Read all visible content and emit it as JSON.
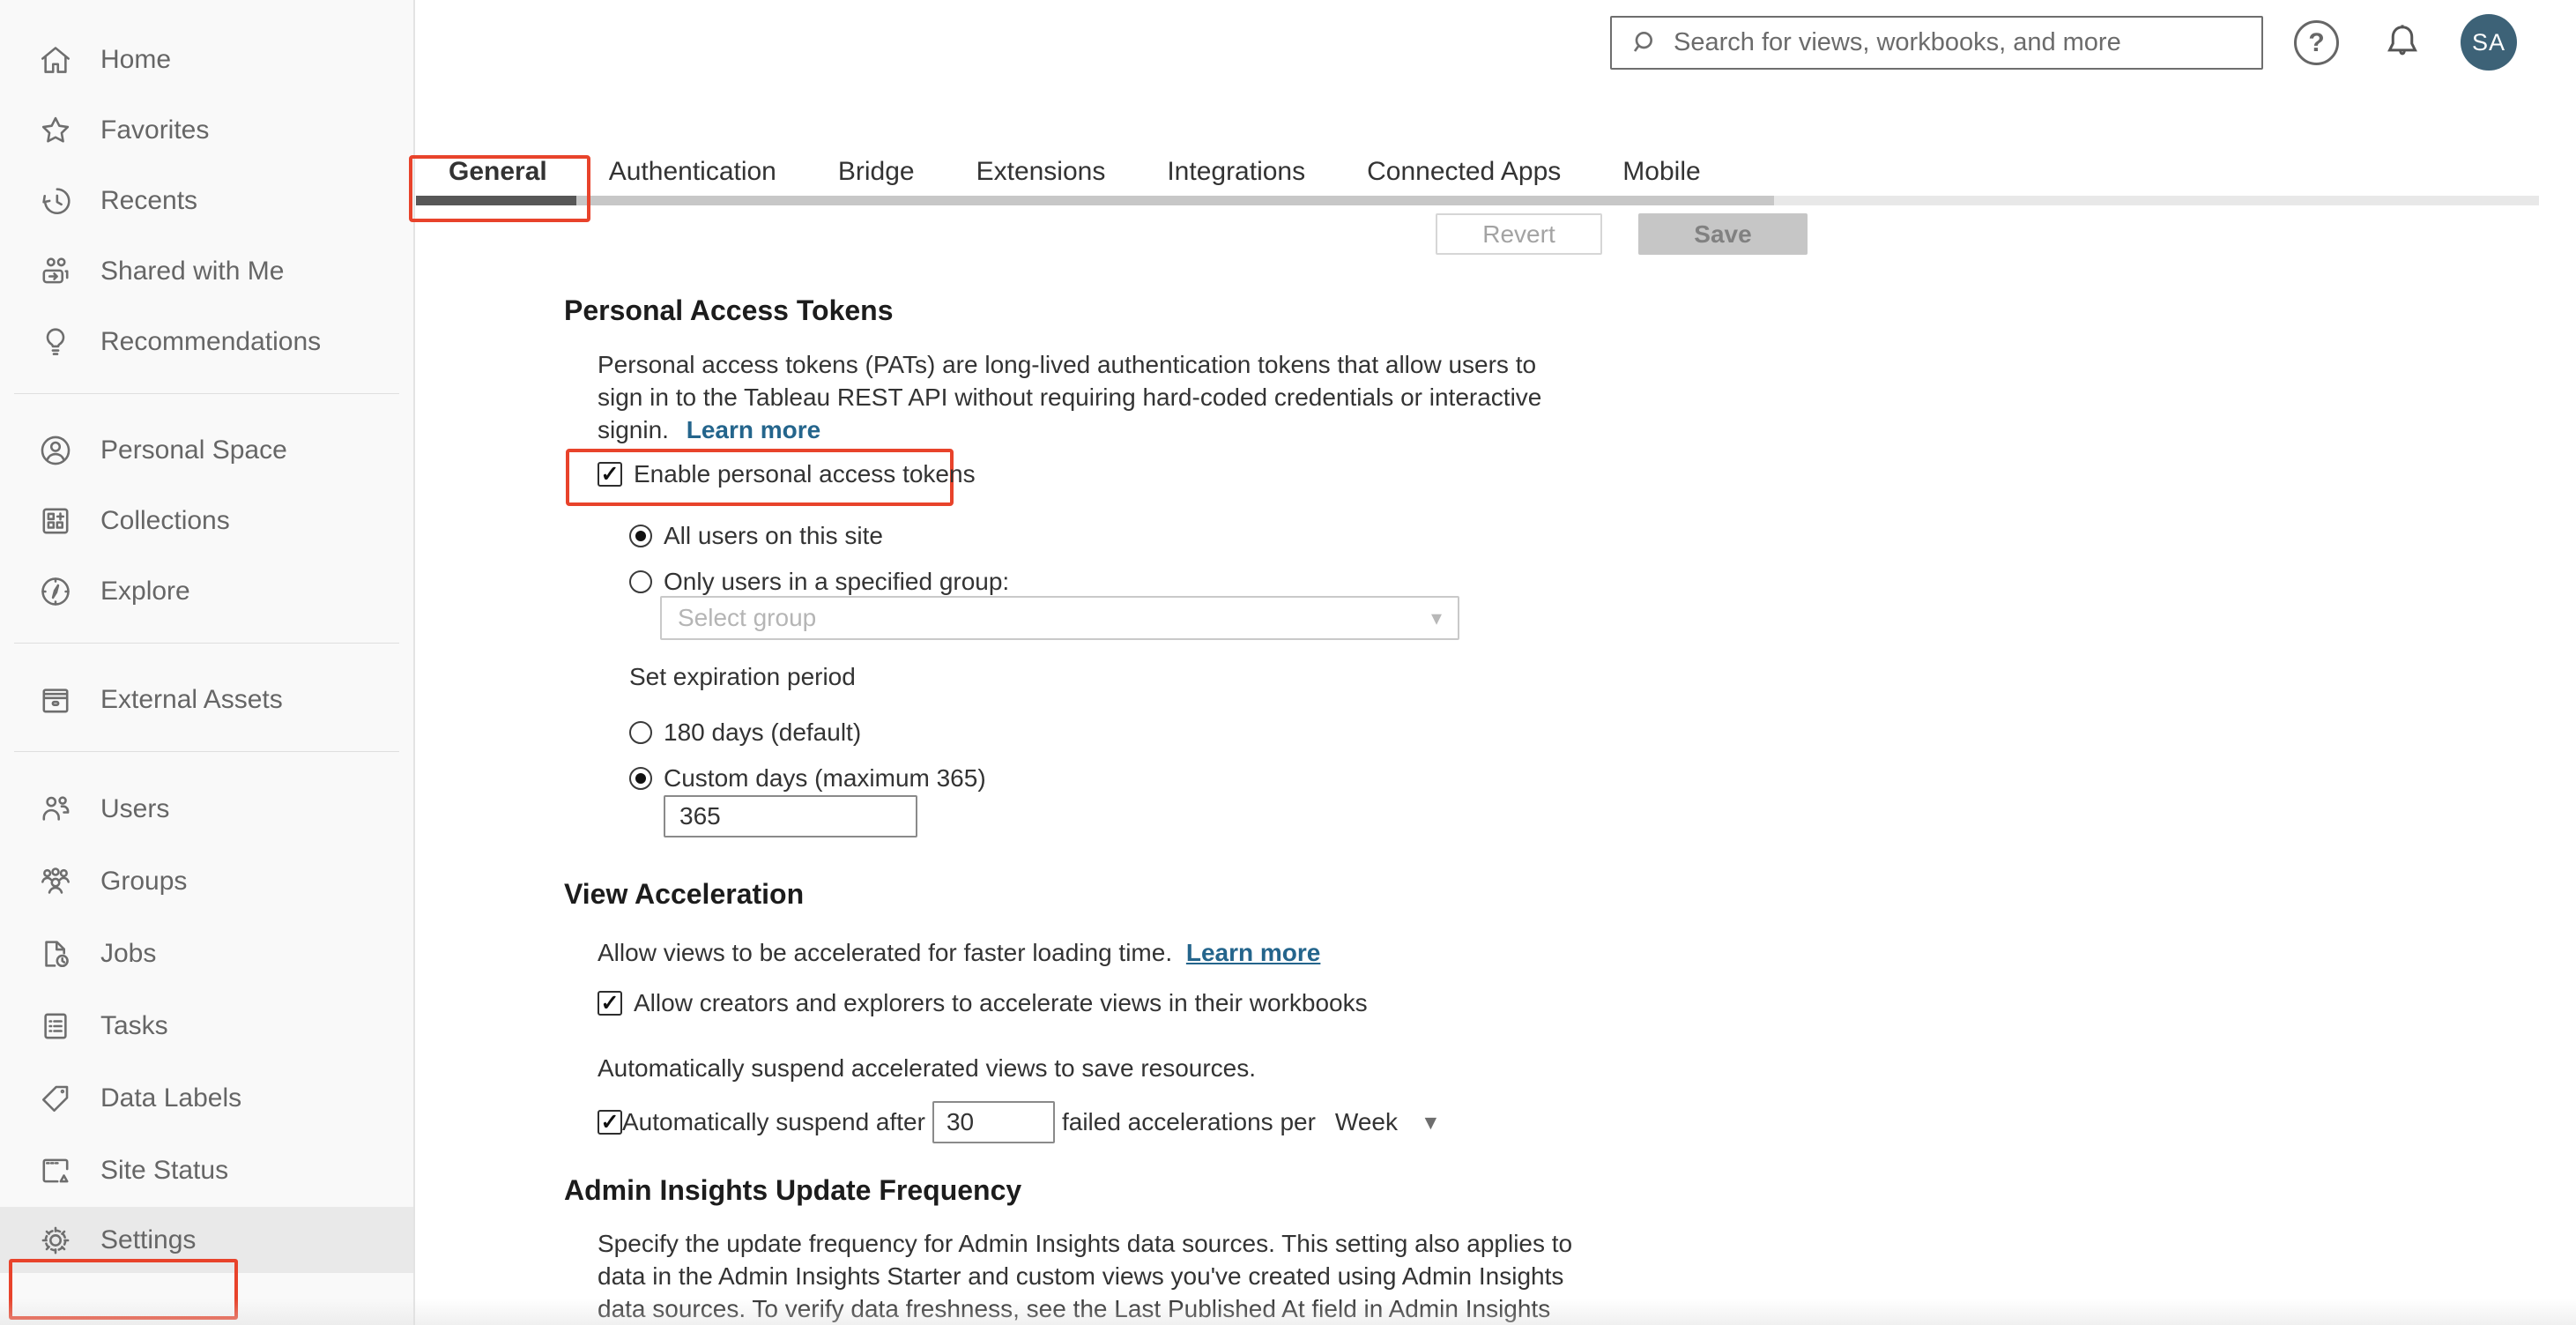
{
  "topbar": {
    "search_placeholder": "Search for views, workbooks, and more",
    "avatar_initials": "SA",
    "help_glyph": "?"
  },
  "sidebar": {
    "items": [
      {
        "icon": "home-icon",
        "label": "Home"
      },
      {
        "icon": "star-icon",
        "label": "Favorites"
      },
      {
        "icon": "recents-clock-icon",
        "label": "Recents"
      },
      {
        "icon": "shared-people-icon",
        "label": "Shared with Me"
      },
      {
        "icon": "lightbulb-icon",
        "label": "Recommendations"
      },
      {
        "icon": "person-circle-icon",
        "label": "Personal Space"
      },
      {
        "icon": "collections-grid-icon",
        "label": "Collections"
      },
      {
        "icon": "compass-icon",
        "label": "Explore"
      },
      {
        "icon": "drawer-icon",
        "label": "External Assets"
      },
      {
        "icon": "users-icon",
        "label": "Users"
      },
      {
        "icon": "groups-icon",
        "label": "Groups"
      },
      {
        "icon": "jobs-document-clock-icon",
        "label": "Jobs"
      },
      {
        "icon": "tasks-clipboard-icon",
        "label": "Tasks"
      },
      {
        "icon": "tag-icon",
        "label": "Data Labels"
      },
      {
        "icon": "site-status-window-icon",
        "label": "Site Status"
      },
      {
        "icon": "gear-icon",
        "label": "Settings"
      }
    ]
  },
  "tabs": {
    "items": [
      {
        "label": "General",
        "active": true
      },
      {
        "label": "Authentication"
      },
      {
        "label": "Bridge"
      },
      {
        "label": "Extensions"
      },
      {
        "label": "Integrations"
      },
      {
        "label": "Connected Apps"
      },
      {
        "label": "Mobile"
      }
    ]
  },
  "actions": {
    "revert": "Revert",
    "save": "Save"
  },
  "content": {
    "pat": {
      "title": "Personal Access Tokens",
      "desc_line1": "Personal access tokens (PATs) are long-lived authentication tokens that allow users to",
      "desc_line2": "sign in to the Tableau REST API without requiring hard-coded credentials or interactive",
      "desc_line3_prefix": "signin.",
      "learn_more": "Learn more",
      "enable_label": "Enable personal access tokens",
      "radio_all_users": "All users on this site",
      "radio_specified_group": "Only users in a specified group:",
      "group_placeholder": "Select group",
      "expiration_label": "Set expiration period",
      "radio_180": "180 days (default)",
      "radio_custom": "Custom days (maximum 365)",
      "custom_days_value": "365"
    },
    "view_accel": {
      "title": "View Acceleration",
      "desc": "Allow views to be accelerated for faster loading time.",
      "learn_more": "Learn more",
      "allow_label": "Allow creators and explorers to accelerate views in their workbooks",
      "suspend_desc": "Automatically suspend accelerated views to save resources.",
      "suspend_prefix": "Automatically suspend after",
      "suspend_value": "30",
      "suspend_suffix": "failed accelerations per",
      "period_value": "Week"
    },
    "admin_insights": {
      "title": "Admin Insights Update Frequency",
      "desc_line1": "Specify the update frequency for Admin Insights data sources. This setting also applies to",
      "desc_line2": "data in the Admin Insights Starter and custom views you've created using Admin Insights",
      "desc_line3": "data sources. To verify data freshness, see the Last Published At field in Admin Insights"
    }
  },
  "colors": {
    "annotation": "#e8432b",
    "link": "#24658c",
    "avatar_bg": "#3d6277",
    "tab_underline": "#575757"
  }
}
